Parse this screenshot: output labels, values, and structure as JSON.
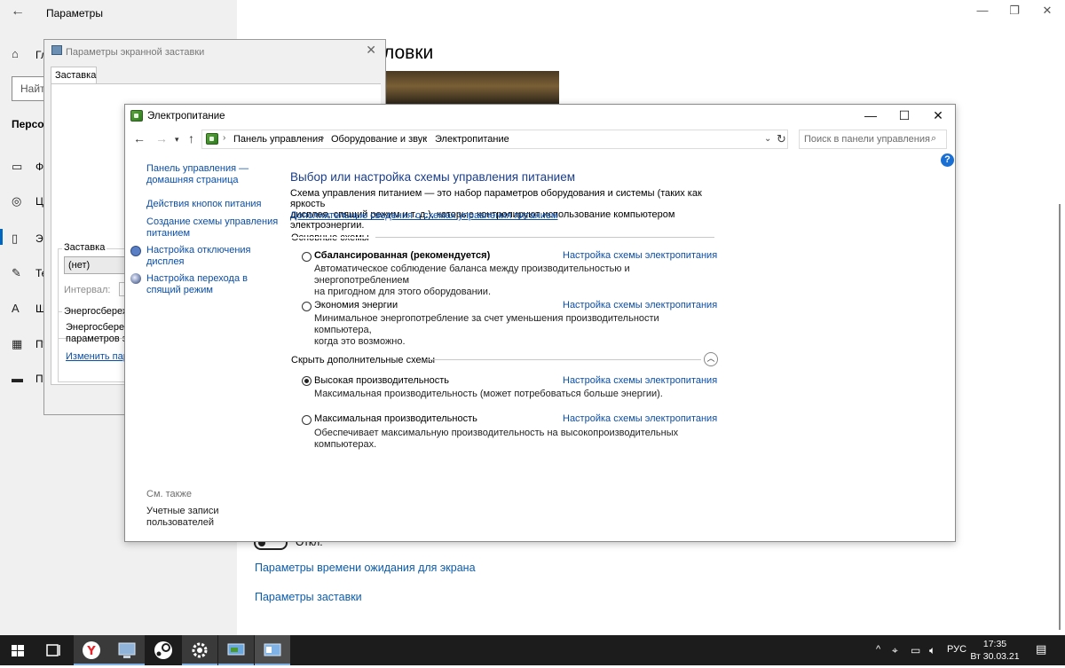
{
  "settings": {
    "title": "Параметры",
    "nav_partial": {
      "home": "Гл",
      "search": "Найт",
      "section": "Персо",
      "items": [
        "Фо",
        "Цв",
        "Эк",
        "Те",
        "Ш",
        "Пу",
        "Па"
      ]
    },
    "heading_partial": "ловки",
    "toggle_label": "Откл.",
    "links": [
      "Параметры времени ожидания для экрана",
      "Параметры заставки"
    ]
  },
  "screensaver": {
    "title": "Параметры экранной заставки",
    "tab": "Заставка",
    "group_label": "Заставка",
    "combo_value": "(нет)",
    "interval_label": "Интервал:",
    "energy_group": "Энергосбереж",
    "energy_text_1": "Энергосбереж",
    "energy_text_2": "параметров эл",
    "energy_link": "Изменить пар"
  },
  "power": {
    "title": "Электропитание",
    "breadcrumbs": [
      "Панель управления",
      "Оборудование и звук",
      "Электропитание"
    ],
    "search_placeholder": "Поиск в панели управления",
    "sidebar": {
      "home_link_1": "Панель управления —",
      "home_link_2": "домашняя страница",
      "buttons_link": "Действия кнопок питания",
      "create_1": "Создание схемы управления",
      "create_2": "питанием",
      "display_1": "Настройка отключения",
      "display_2": "дисплея",
      "sleep_1": "Настройка перехода в",
      "sleep_2": "спящий режим",
      "see_also": "См. также",
      "accounts_1": "Учетные записи",
      "accounts_2": "пользователей"
    },
    "heading": "Выбор или настройка схемы управления питанием",
    "description_1": "Схема управления питанием — это набор параметров оборудования и системы (таких как яркость",
    "description_2": "дисплея, спящий режим и т. д.), которые контролируют использование компьютером электроэнергии.",
    "more_info_link": "Дополнительные сведения о схемах управления питанием",
    "main_plans_header": "Основные схемы",
    "hidden_plans_header": "Скрыть дополнительные схемы",
    "plan_settings_link": "Настройка схемы электропитания",
    "plans": [
      {
        "name": "Сбалансированная (рекомендуется)",
        "desc_1": "Автоматическое соблюдение баланса между производительностью и энергопотреблением",
        "desc_2": "на пригодном для этого оборудовании.",
        "selected": false
      },
      {
        "name": "Экономия энергии",
        "desc_1": "Минимальное энергопотребление за счет уменьшения производительности компьютера,",
        "desc_2": "когда это возможно.",
        "selected": false
      },
      {
        "name": "Высокая производительность",
        "desc_1": "Максимальная производительность (может потребоваться больше энергии).",
        "desc_2": "",
        "selected": true
      },
      {
        "name": "Максимальная производительность",
        "desc_1": "Обеспечивает максимальную производительность на высокопроизводительных",
        "desc_2": "компьютерах.",
        "selected": false
      }
    ]
  },
  "taskbar": {
    "language": "РУС",
    "time": "17:35",
    "date": "Вт 30.03.21"
  },
  "colors": {
    "link": "#0a4ea8",
    "heading": "#1a3d8a",
    "taskbar": "#1c1c1c",
    "settings_pane": "#f0f0f0"
  }
}
